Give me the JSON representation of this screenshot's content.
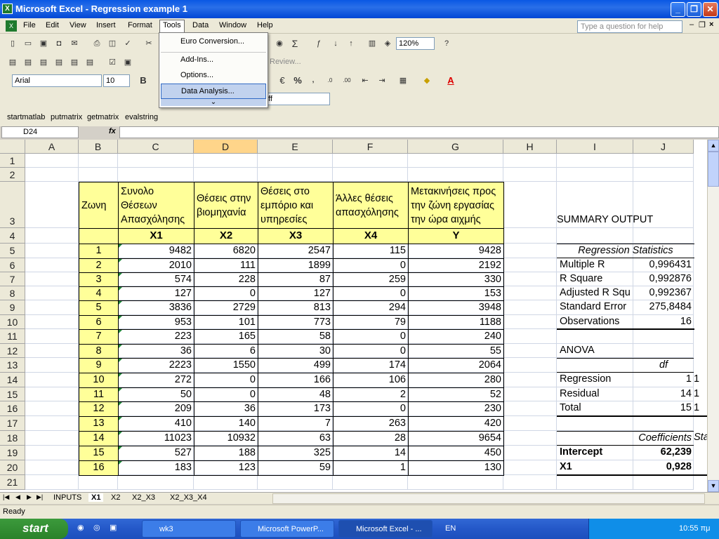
{
  "window": {
    "title": "Microsoft Excel - Regression example 1",
    "min": "_",
    "restore": "❐",
    "close": "✕"
  },
  "menu": {
    "items": [
      "File",
      "Edit",
      "View",
      "Insert",
      "Format",
      "Tools",
      "Data",
      "Window",
      "Help"
    ],
    "help_placeholder": "Type a question for help"
  },
  "tools_menu": {
    "items": [
      "Euro Conversion...",
      "Add-Ins...",
      "Options...",
      "Data Analysis..."
    ],
    "expand": "⌄"
  },
  "toolbar": {
    "zoom": "120%",
    "font": "Arial",
    "size": "10",
    "review": "Review...",
    "ff": "ff"
  },
  "custom_toolbar": [
    "startmatlab",
    "putmatrix",
    "getmatrix",
    "evalstring"
  ],
  "namebox": "D24",
  "fx": "fx",
  "columns": [
    "A",
    "B",
    "C",
    "D",
    "E",
    "F",
    "G",
    "H",
    "I",
    "J"
  ],
  "rows": [
    "1",
    "2",
    "3",
    "4",
    "5",
    "6",
    "7",
    "8",
    "9",
    "10",
    "11",
    "12",
    "13",
    "14",
    "15",
    "16",
    "17",
    "18",
    "19",
    "20",
    "21"
  ],
  "headers": {
    "zone": "Ζωνη",
    "c": "Συνολο Θέσεων Απασχόλησης",
    "d": "Θέσεις στην βιομηχανία",
    "e": "Θέσεις στο εμπόριο και υπηρεσίες",
    "f": "Άλλες θέσεις απασχόλησης",
    "g": "Μετακινήσεις προς την ζώνη εργασίας την ώρα αιχμής",
    "x1": "X1",
    "x2": "X2",
    "x3": "X3",
    "x4": "X4",
    "y": "Y"
  },
  "table": [
    [
      "1",
      "9482",
      "6820",
      "2547",
      "115",
      "9428"
    ],
    [
      "2",
      "2010",
      "111",
      "1899",
      "0",
      "2192"
    ],
    [
      "3",
      "574",
      "228",
      "87",
      "259",
      "330"
    ],
    [
      "4",
      "127",
      "0",
      "127",
      "0",
      "153"
    ],
    [
      "5",
      "3836",
      "2729",
      "813",
      "294",
      "3948"
    ],
    [
      "6",
      "953",
      "101",
      "773",
      "79",
      "1188"
    ],
    [
      "7",
      "223",
      "165",
      "58",
      "0",
      "240"
    ],
    [
      "8",
      "36",
      "6",
      "30",
      "0",
      "55"
    ],
    [
      "9",
      "2223",
      "1550",
      "499",
      "174",
      "2064"
    ],
    [
      "10",
      "272",
      "0",
      "166",
      "106",
      "280"
    ],
    [
      "11",
      "50",
      "0",
      "48",
      "2",
      "52"
    ],
    [
      "12",
      "209",
      "36",
      "173",
      "0",
      "230"
    ],
    [
      "13",
      "410",
      "140",
      "7",
      "263",
      "420"
    ],
    [
      "14",
      "11023",
      "10932",
      "63",
      "28",
      "9654"
    ],
    [
      "15",
      "527",
      "188",
      "325",
      "14",
      "450"
    ],
    [
      "16",
      "183",
      "123",
      "59",
      "1",
      "130"
    ]
  ],
  "summary": {
    "title": "SUMMARY OUTPUT",
    "regstats": "Regression Statistics",
    "stats": [
      [
        "Multiple R",
        "0,996431"
      ],
      [
        "R Square",
        "0,992876"
      ],
      [
        "Adjusted R Squ",
        "0,992367"
      ],
      [
        "Standard Error",
        "275,8484"
      ],
      [
        "Observations",
        "16"
      ]
    ],
    "anova": "ANOVA",
    "df": "df",
    "anova_rows": [
      [
        "Regression",
        "1"
      ],
      [
        "Residual",
        "14"
      ],
      [
        "Total",
        "15"
      ]
    ],
    "coef": "Coefficients",
    "coef_rows": [
      [
        "Intercept",
        "62,239"
      ],
      [
        "X1",
        "0,928"
      ]
    ]
  },
  "sheets": [
    "INPUTS",
    "X1",
    "X2",
    "X2_X3",
    "X2_X3_X4"
  ],
  "status": "Ready",
  "taskbar": {
    "start": "start",
    "tasks": [
      "wk3",
      "Microsoft PowerP...",
      "Microsoft Excel - ..."
    ],
    "lang": "EN",
    "clock": "10:55 πμ"
  }
}
